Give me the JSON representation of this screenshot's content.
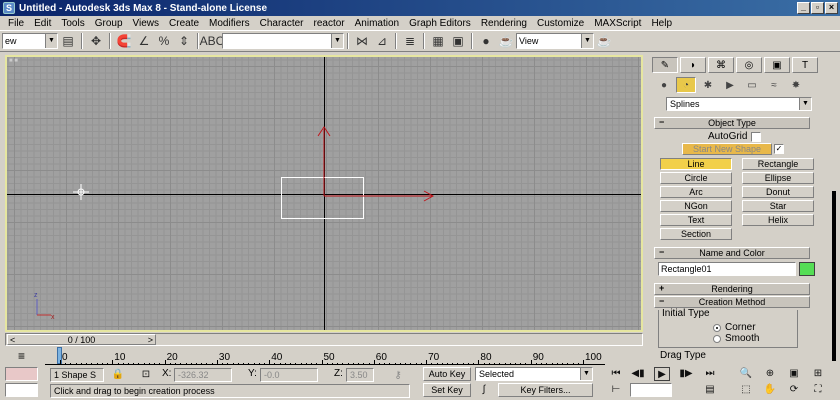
{
  "window": {
    "title": "Untitled  - Autodesk 3ds Max 8  - Stand-alone License",
    "app_icon": "S"
  },
  "menu": [
    "File",
    "Edit",
    "Tools",
    "Group",
    "Views",
    "Create",
    "Modifiers",
    "Character",
    "reactor",
    "Animation",
    "Graph Editors",
    "Rendering",
    "Customize",
    "MAXScript",
    "Help"
  ],
  "toolbar": {
    "selection_filter": "ew",
    "named_selection": "",
    "ref_coord": "View"
  },
  "command_panel": {
    "category": "Splines",
    "object_type": {
      "header": "Object Type",
      "autogrid_label": "AutoGrid",
      "start_new_shape_label": "Start New Shape",
      "start_new_shape_checked": "✓",
      "buttons": [
        "Line",
        "Rectangle",
        "Circle",
        "Ellipse",
        "Arc",
        "Donut",
        "NGon",
        "Star",
        "Text",
        "Helix",
        "Section"
      ],
      "active_button": "Line"
    },
    "name_color": {
      "header": "Name and Color",
      "name": "Rectangle01",
      "color": "#55dd55"
    },
    "rendering": {
      "header": "Rendering"
    },
    "creation_method": {
      "header": "Creation Method",
      "initial_type_label": "Initial Type",
      "corner_label": "Corner",
      "smooth_label": "Smooth",
      "drag_type_label": "Drag Type"
    }
  },
  "time_slider": {
    "label": "0 / 100",
    "prev": "<",
    "next": ">"
  },
  "trackbar": {
    "ticks": [
      "0",
      "10",
      "20",
      "30",
      "40",
      "50",
      "60",
      "70",
      "80",
      "90",
      "100"
    ]
  },
  "status": {
    "selection": "1 Shape S",
    "x_label": "X:",
    "x_value": "-326.32",
    "y_label": "Y:",
    "y_value": "-0.0",
    "z_label": "Z:",
    "z_value": "3.50",
    "prompt": "Click and drag to begin creation process",
    "auto_key": "Auto Key",
    "set_key": "Set Key",
    "key_mode": "Selected",
    "key_filters": "Key Filters..."
  }
}
